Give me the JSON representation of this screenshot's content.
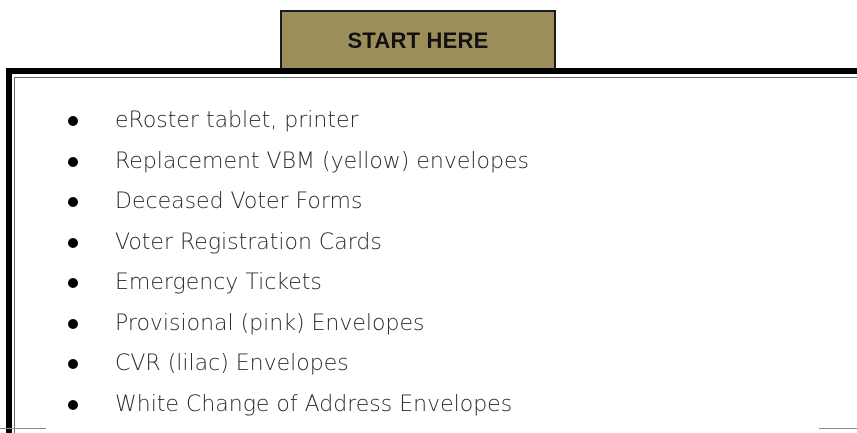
{
  "header": {
    "title": "START HERE"
  },
  "checklist": {
    "items": [
      {
        "label": "eRoster tablet, printer"
      },
      {
        "label": "Replacement VBM (yellow) envelopes"
      },
      {
        "label": "Deceased Voter Forms"
      },
      {
        "label": "Voter Registration Cards"
      },
      {
        "label": "Emergency Tickets"
      },
      {
        "label": "Provisional (pink) Envelopes"
      },
      {
        "label": "CVR (lilac) Envelopes"
      },
      {
        "label": "White Change of Address Envelopes"
      }
    ]
  },
  "colors": {
    "tab_fill": "#9c8e58",
    "border": "#000000",
    "text": "#2b2b2b"
  }
}
